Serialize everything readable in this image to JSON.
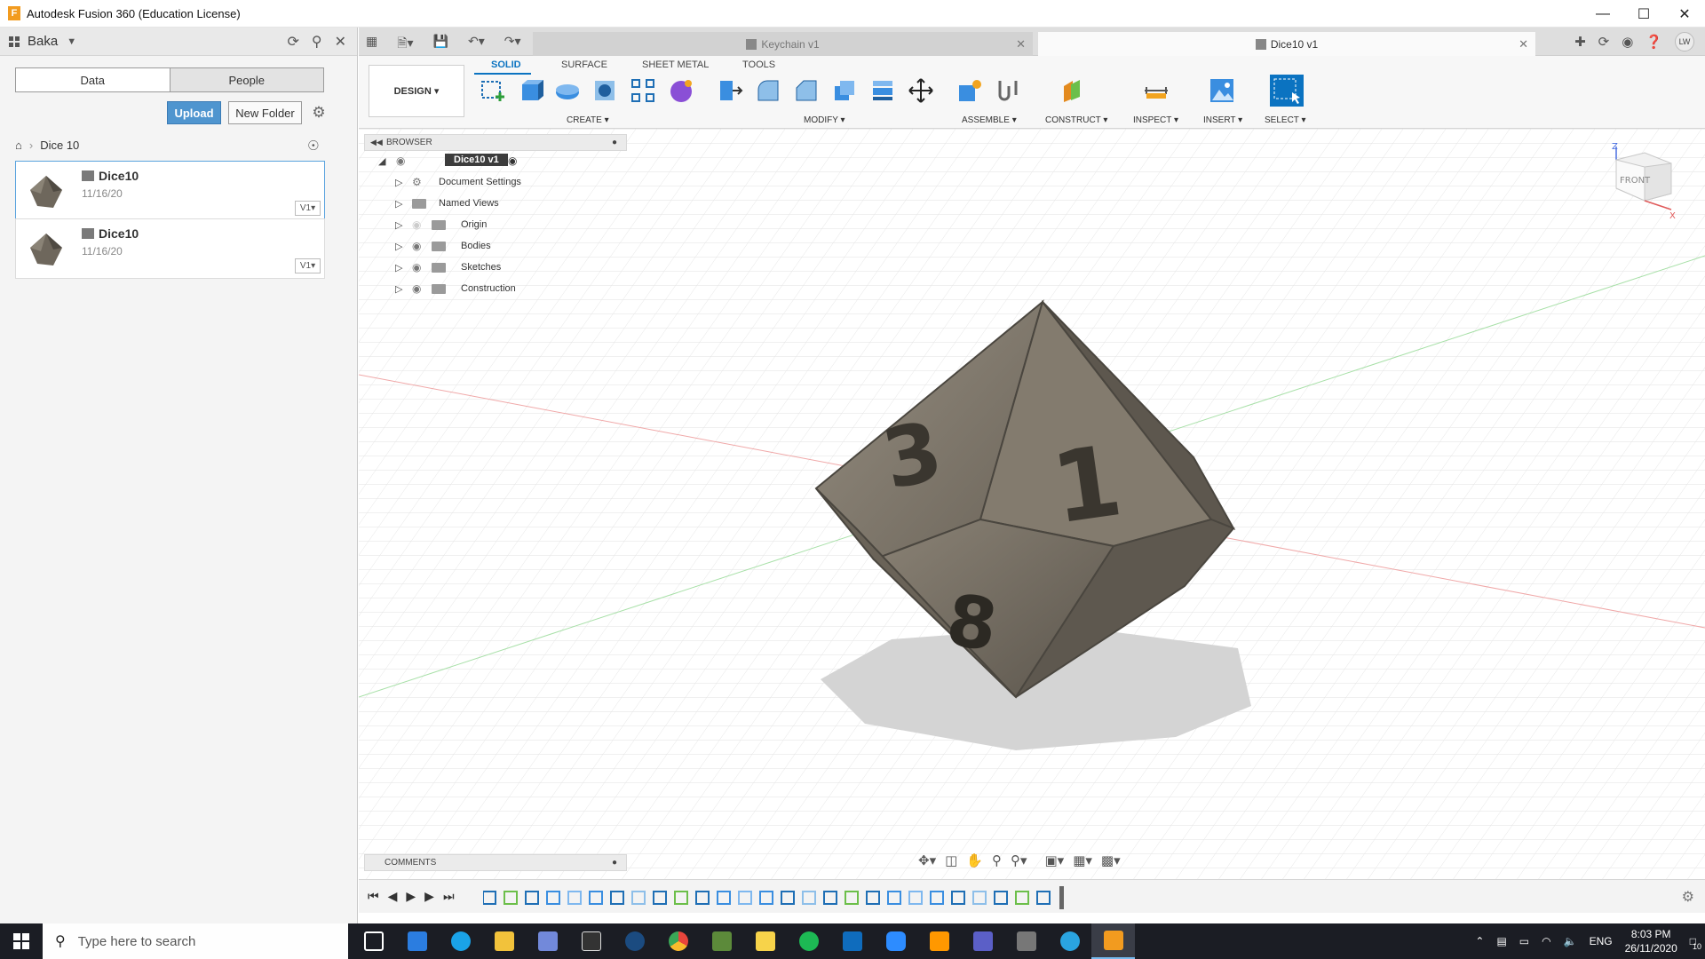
{
  "window": {
    "title": "Autodesk Fusion 360 (Education License)",
    "logo_letter": "F"
  },
  "data_panel": {
    "team": "Baka",
    "tabs": [
      "Data",
      "People"
    ],
    "upload_label": "Upload",
    "new_folder_label": "New Folder",
    "breadcrumb": "Dice 10",
    "files": [
      {
        "name": "Dice10",
        "date": "11/16/20",
        "version": "V1"
      },
      {
        "name": "Dice10",
        "date": "11/16/20",
        "version": "V1"
      }
    ]
  },
  "doc_tabs": {
    "inactive": "Keychain v1",
    "active": "Dice10 v1",
    "user_initials": "LW"
  },
  "toolbar": {
    "workspace": "DESIGN",
    "tabs": [
      "SOLID",
      "SURFACE",
      "SHEET METAL",
      "TOOLS"
    ],
    "groups": [
      "CREATE",
      "MODIFY",
      "ASSEMBLE",
      "CONSTRUCT",
      "INSPECT",
      "INSERT",
      "SELECT"
    ]
  },
  "browser": {
    "title": "BROWSER",
    "root": "Dice10 v1",
    "items": [
      "Document Settings",
      "Named Views",
      "Origin",
      "Bodies",
      "Sketches",
      "Construction"
    ]
  },
  "viewcube": {
    "face": "FRONT",
    "axis_z": "Z",
    "axis_x": "X"
  },
  "model": {
    "face_numbers": [
      "3",
      "1",
      "8"
    ]
  },
  "comments_label": "COMMENTS",
  "taskbar": {
    "search_placeholder": "Type here to search",
    "language": "ENG",
    "time": "8:03 PM",
    "date": "26/11/2020",
    "notification_count": "10"
  },
  "colors": {
    "accent": "#0b73c1",
    "upload": "#4f95cf",
    "model_body": "#7d7567",
    "taskbar": "#1b1d24"
  }
}
